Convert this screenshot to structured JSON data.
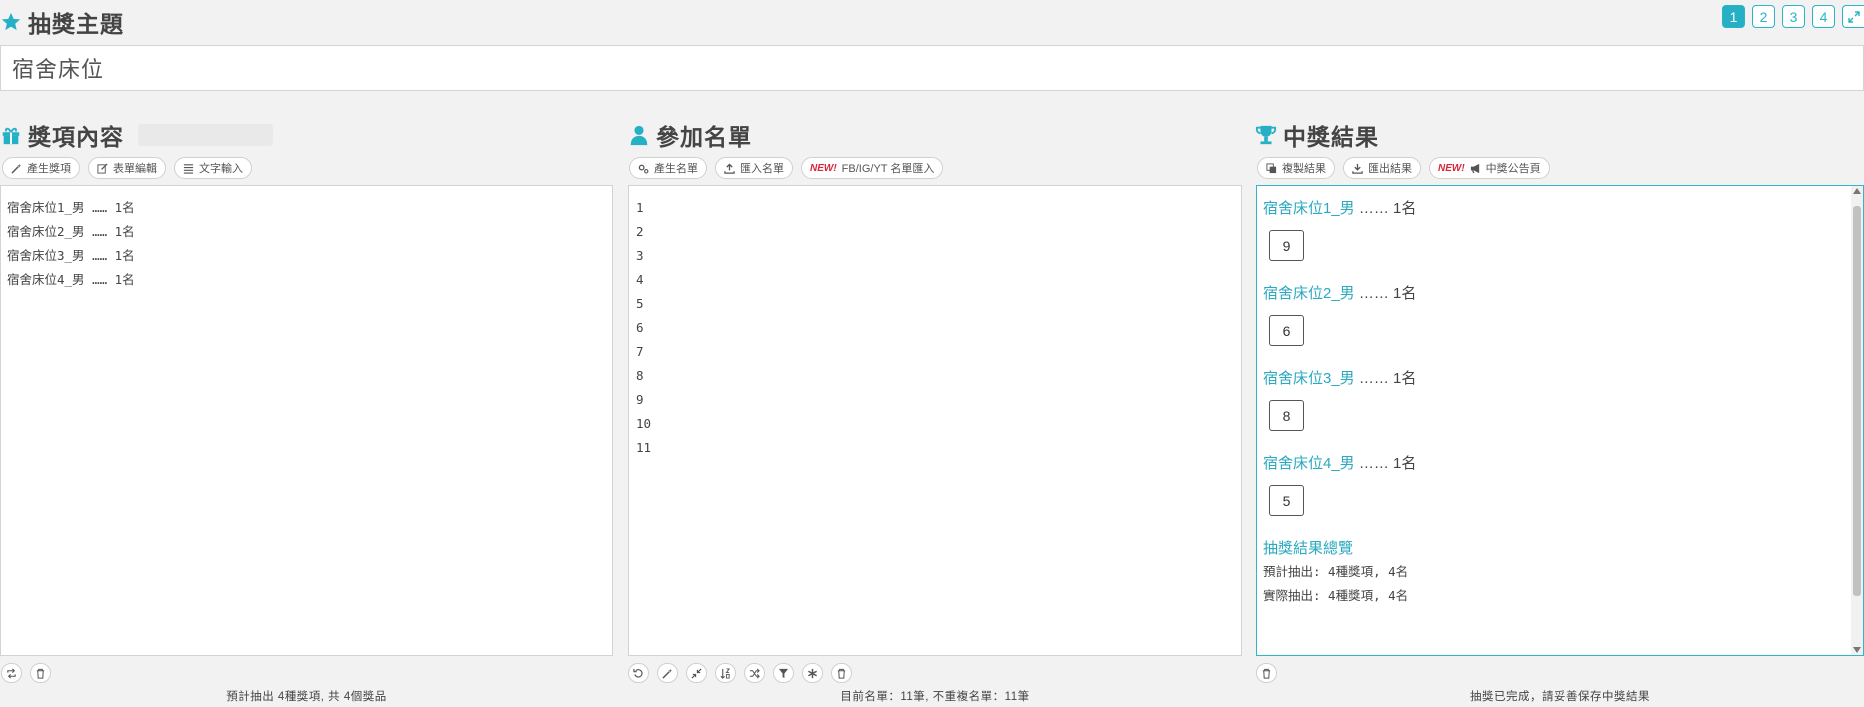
{
  "header": {
    "title": "抽獎主題",
    "topic_value": "宿舍床位",
    "pages": [
      "1",
      "2",
      "3",
      "4"
    ],
    "active_page": "1"
  },
  "prizes": {
    "title": "獎項內容",
    "tools": [
      "產生獎項",
      "表單編輯",
      "文字輸入"
    ],
    "items": [
      "宿舍床位1_男 …… 1名",
      "宿舍床位2_男 …… 1名",
      "宿舍床位3_男 …… 1名",
      "宿舍床位4_男 …… 1名"
    ],
    "status": "預計抽出 4種獎項, 共 4個獎品"
  },
  "participants": {
    "title": "參加名單",
    "tools": [
      "產生名單",
      "匯入名單"
    ],
    "new_badge": "NEW!",
    "social_import": "FB/IG/YT 名單匯入",
    "items": [
      "1",
      "2",
      "3",
      "4",
      "5",
      "6",
      "7",
      "8",
      "9",
      "10",
      "11"
    ],
    "status": "目前名單：11筆, 不重複名單：11筆"
  },
  "results": {
    "title": "中獎結果",
    "tools": [
      "複製結果",
      "匯出結果"
    ],
    "new_badge": "NEW!",
    "announce": "中獎公告頁",
    "groups": [
      {
        "prize": "宿舍床位1_男",
        "count": "…… 1名",
        "winner": "9"
      },
      {
        "prize": "宿舍床位2_男",
        "count": "…… 1名",
        "winner": "6"
      },
      {
        "prize": "宿舍床位3_男",
        "count": "…… 1名",
        "winner": "8"
      },
      {
        "prize": "宿舍床位4_男",
        "count": "…… 1名",
        "winner": "5"
      }
    ],
    "overview_title": "抽獎結果總覽",
    "overview_lines": [
      "預計抽出: 4種獎項, 4名",
      "實際抽出: 4種獎項, 4名"
    ],
    "status": "抽獎已完成，請妥善保存中獎結果"
  },
  "colors": {
    "accent": "#26b0c6",
    "new": "#d9273b"
  },
  "icons": [
    "star-icon",
    "gift-icon",
    "user-icon",
    "trophy-icon",
    "expand-icon"
  ]
}
